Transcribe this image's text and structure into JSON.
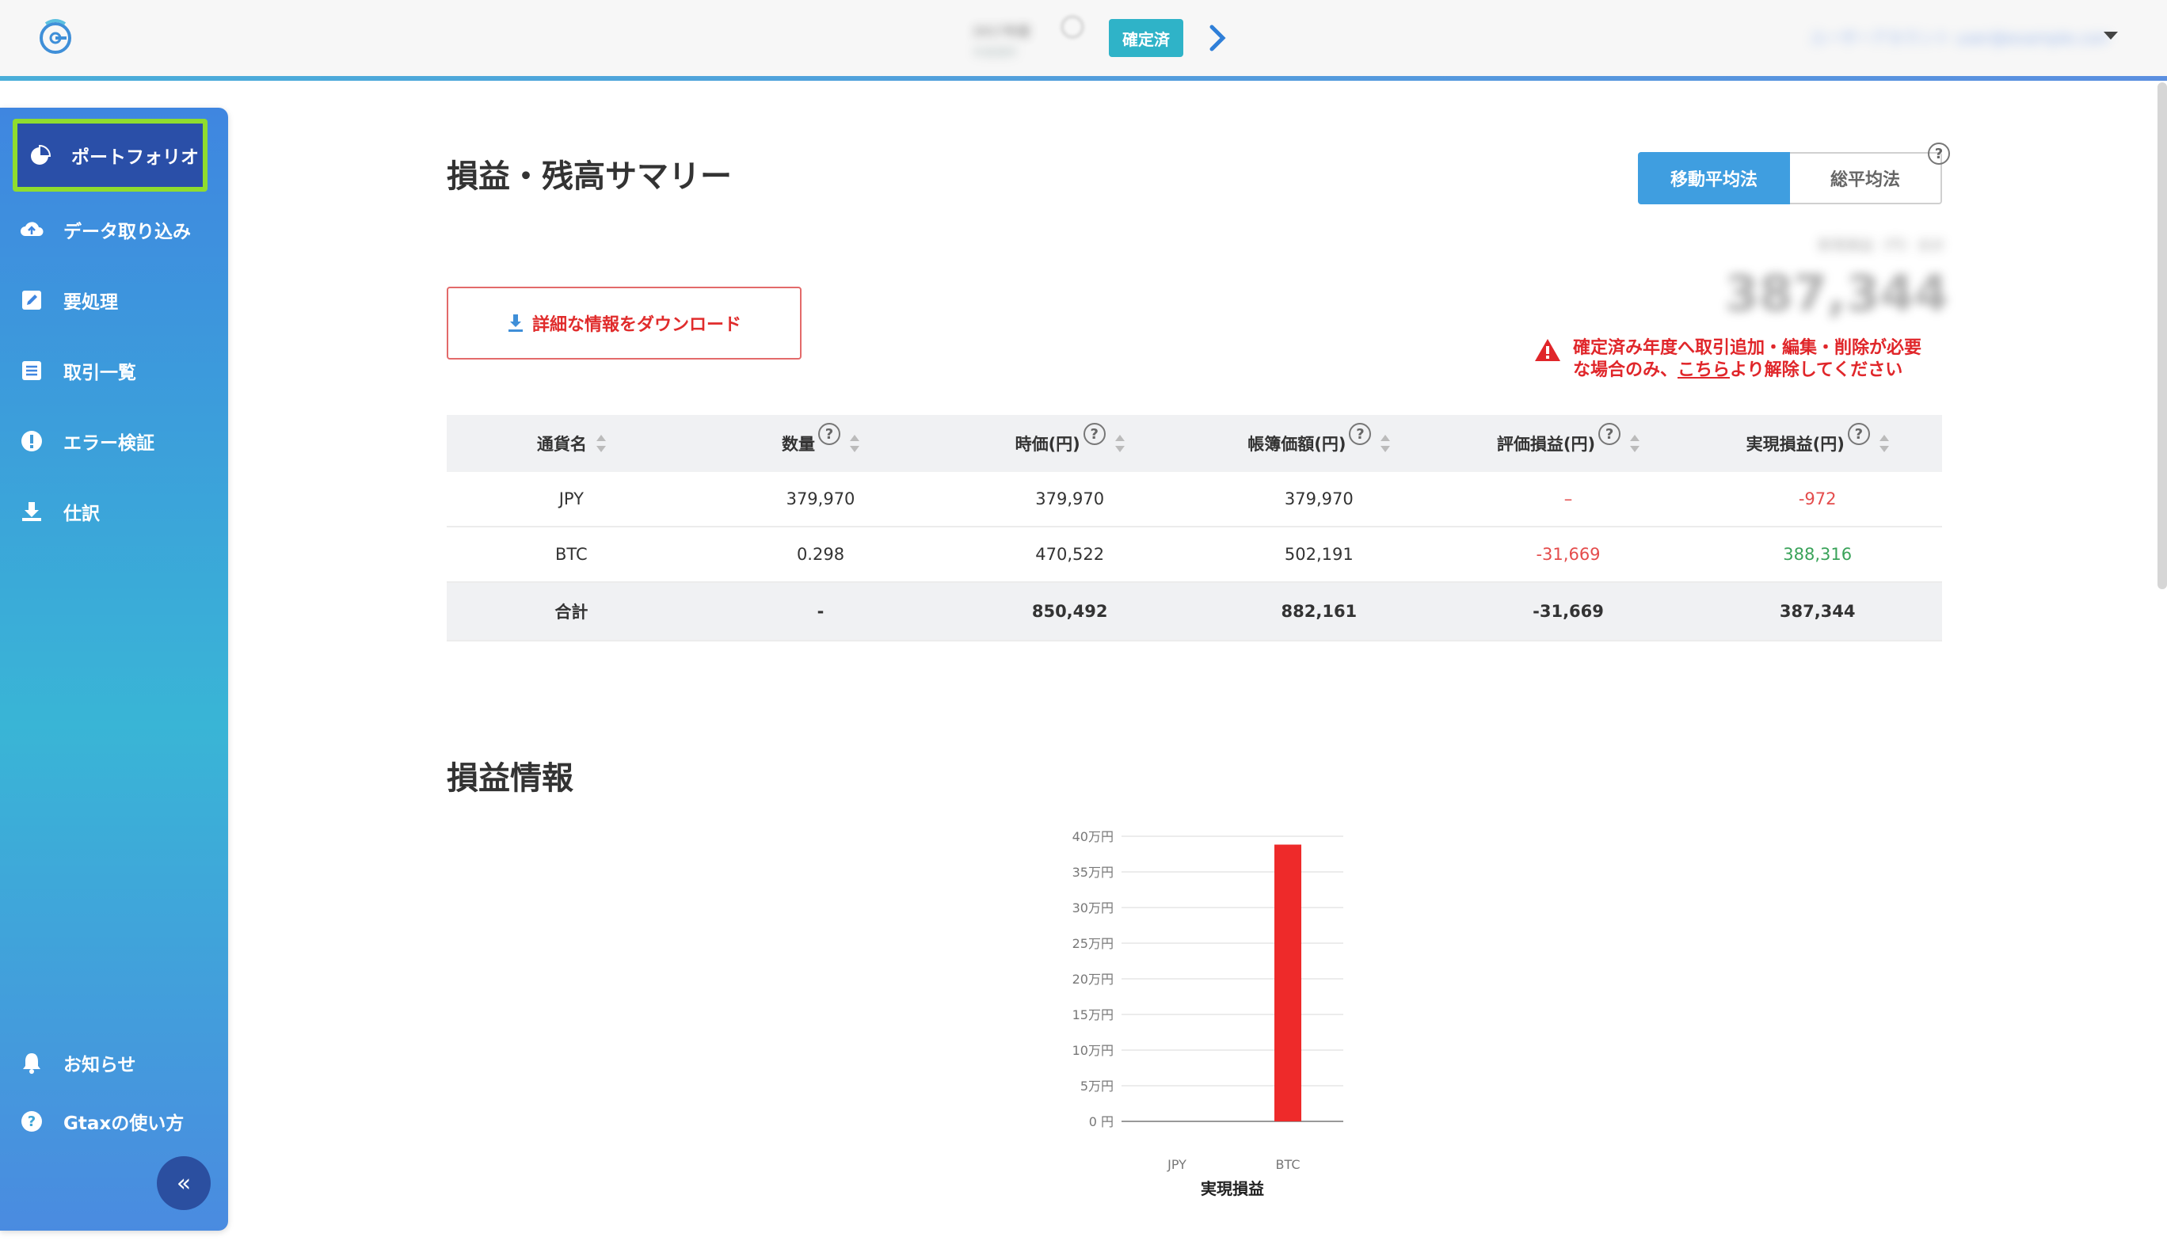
{
  "header": {
    "year_label": "2017年度",
    "year_sub": "年度選択",
    "status": "確定済",
    "user": "ユーザーアカウント user@example.com"
  },
  "sidebar": {
    "items": [
      {
        "label": "ポートフォリオ",
        "icon": "pie-chart-icon"
      },
      {
        "label": "データ取り込み",
        "icon": "cloud-upload-icon"
      },
      {
        "label": "要処理",
        "icon": "edit-icon"
      },
      {
        "label": "取引一覧",
        "icon": "list-icon"
      },
      {
        "label": "エラー検証",
        "icon": "alert-circle-icon"
      },
      {
        "label": "仕訳",
        "icon": "download-icon"
      }
    ],
    "bottom_items": [
      {
        "label": "お知らせ",
        "icon": "bell-icon"
      },
      {
        "label": "Gtaxの使い方",
        "icon": "help-circle-icon"
      }
    ],
    "collapse": "«"
  },
  "main": {
    "title": "損益・残高サマリー",
    "method_tabs": [
      "移動平均法",
      "総平均法"
    ],
    "total_label": "実現損益（円）合計",
    "total_value": "387,344",
    "warning_line1": "確定済み年度へ取引追加・編集・削除が必要",
    "warning_pre": "な場合のみ、",
    "warning_link": "こちら",
    "warning_post": "より解除してください",
    "download": "詳細な情報をダウンロード",
    "section_title": "損益情報"
  },
  "table": {
    "headers": [
      "通貨名",
      "数量",
      "時価(円)",
      "帳簿価額(円)",
      "評価損益(円)",
      "実現損益(円)"
    ],
    "rows": [
      [
        "JPY",
        "379,970",
        "379,970",
        "379,970",
        "–",
        "-972"
      ],
      [
        "BTC",
        "0.298",
        "470,522",
        "502,191",
        "-31,669",
        "388,316"
      ]
    ],
    "total": [
      "合計",
      "-",
      "850,492",
      "882,161",
      "-31,669",
      "387,344"
    ]
  },
  "colors": {
    "accent": "#3f9ee0",
    "badge": "#2fb3c8",
    "negative": "#e44c4c",
    "positive": "#3aa35a",
    "bar": "#ee2a2a"
  },
  "chart_data": {
    "type": "bar",
    "categories": [
      "JPY",
      "BTC"
    ],
    "values": [
      -972,
      388316
    ],
    "xlabel": "実現損益",
    "ylabel": "",
    "ylim": [
      0,
      400000
    ],
    "yticks": [
      "0 円",
      "5万円",
      "10万円",
      "15万円",
      "20万円",
      "25万円",
      "30万円",
      "35万円",
      "40万円"
    ],
    "grid": true
  }
}
